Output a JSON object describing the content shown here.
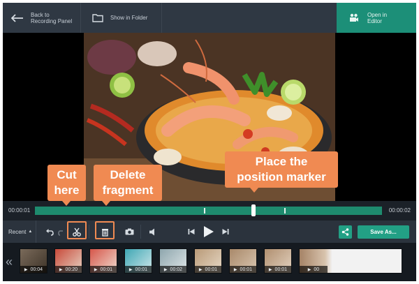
{
  "toolbar": {
    "back_label": "Back to\nRecording Panel",
    "back_line1": "Back to",
    "back_line2": "Recording Panel",
    "folder_label": "Show in Folder",
    "editor_line1": "Open in",
    "editor_line2": "Editor"
  },
  "timeline": {
    "start_time": "00:00:01",
    "end_time": "00:00:02",
    "marker_position_fraction": 0.63
  },
  "controls": {
    "recent_label": "Recent",
    "save_label": "Save As..."
  },
  "thumbnails": [
    {
      "time": "00:04"
    },
    {
      "time": "00:20"
    },
    {
      "time": "00:01"
    },
    {
      "time": "00:01"
    },
    {
      "time": "00:02"
    },
    {
      "time": "00:01"
    },
    {
      "time": "00:01"
    },
    {
      "time": "00:01"
    },
    {
      "time": "00"
    }
  ],
  "callouts": {
    "cut_line1": "Cut",
    "cut_line2": "here",
    "delete_line1": "Delete",
    "delete_line2": "fragment",
    "marker_line1": "Place the",
    "marker_line2": "position marker"
  },
  "colors": {
    "accent": "#22a085",
    "callout": "#f08a52",
    "toolbar": "#2f3843"
  }
}
